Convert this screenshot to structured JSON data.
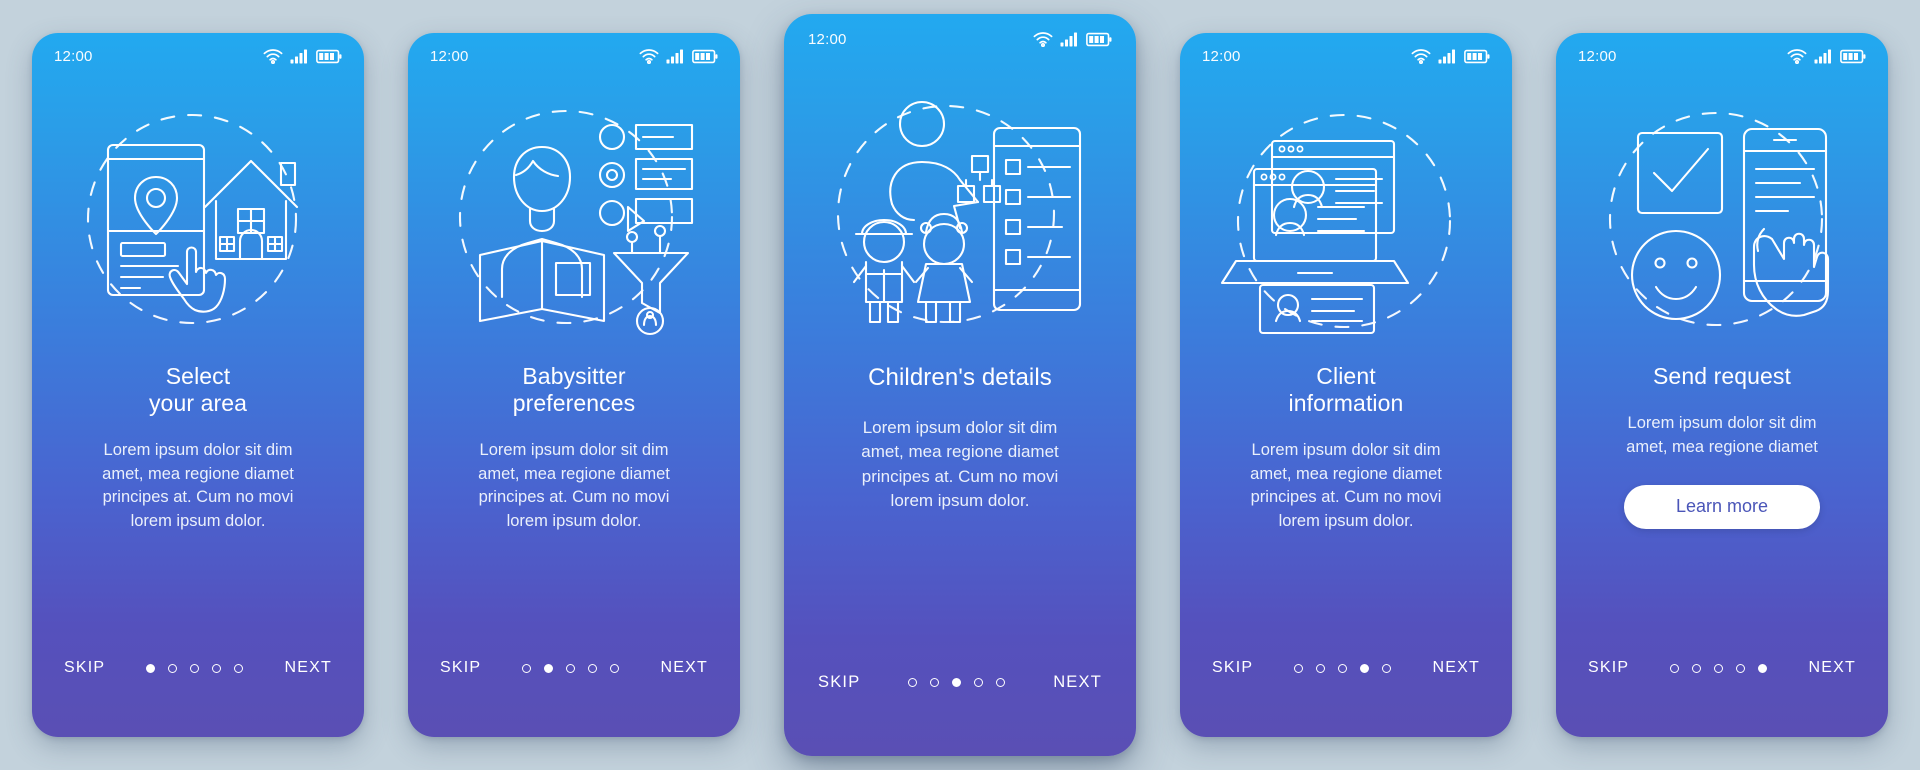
{
  "canvas": {
    "background_color": "#c3d2dc",
    "card_gradient_top": "#22a9f0",
    "card_gradient_bottom": "#5a4fb4",
    "accent_text_color": "#ffffff",
    "learn_more_text_color": "#4a55b8"
  },
  "status": {
    "time": "12:00",
    "wifi_icon": "wifi-icon",
    "signal_icon": "cellular-signal-icon",
    "battery_icon": "battery-icon"
  },
  "nav_labels": {
    "skip": "SKIP",
    "next": "NEXT"
  },
  "screens": [
    {
      "id": "select-your-area",
      "illustration": "map-pin-phone-house-tap-icon",
      "title": "Select\nyour area",
      "body": "Lorem ipsum dolor sit dim\namet, mea regione diamet\nprincipes at. Cum no movi\nlorem ipsum dolor.",
      "dots": 5,
      "active_dot": 0,
      "has_learn_more": false,
      "featured": false
    },
    {
      "id": "babysitter-preferences",
      "illustration": "woman-reading-options-filter-icon",
      "title": "Babysitter\npreferences",
      "body": "Lorem ipsum dolor sit dim\namet, mea regione diamet\nprincipes at. Cum no movi\nlorem ipsum dolor.",
      "dots": 5,
      "active_dot": 1,
      "has_learn_more": false,
      "featured": false
    },
    {
      "id": "childrens-details",
      "illustration": "parent-children-form-tablet-icon",
      "title": "Children's details",
      "body": "Lorem ipsum dolor sit dim\namet, mea regione diamet\nprincipes at. Cum no movi\nlorem ipsum dolor.",
      "dots": 5,
      "active_dot": 2,
      "has_learn_more": false,
      "featured": true
    },
    {
      "id": "client-information",
      "illustration": "laptop-profile-card-icon",
      "title": "Client\ninformation",
      "body": "Lorem ipsum dolor sit dim\namet, mea regione diamet\nprincipes at. Cum no movi\nlorem ipsum dolor.",
      "dots": 5,
      "active_dot": 3,
      "has_learn_more": false,
      "featured": false
    },
    {
      "id": "send-request",
      "illustration": "checkbox-smiley-phone-tap-icon",
      "title": "Send request",
      "body": "Lorem ipsum dolor sit dim\namet, mea regione diamet",
      "dots": 5,
      "active_dot": 4,
      "has_learn_more": true,
      "learn_more_label": "Learn more",
      "featured": false
    }
  ]
}
